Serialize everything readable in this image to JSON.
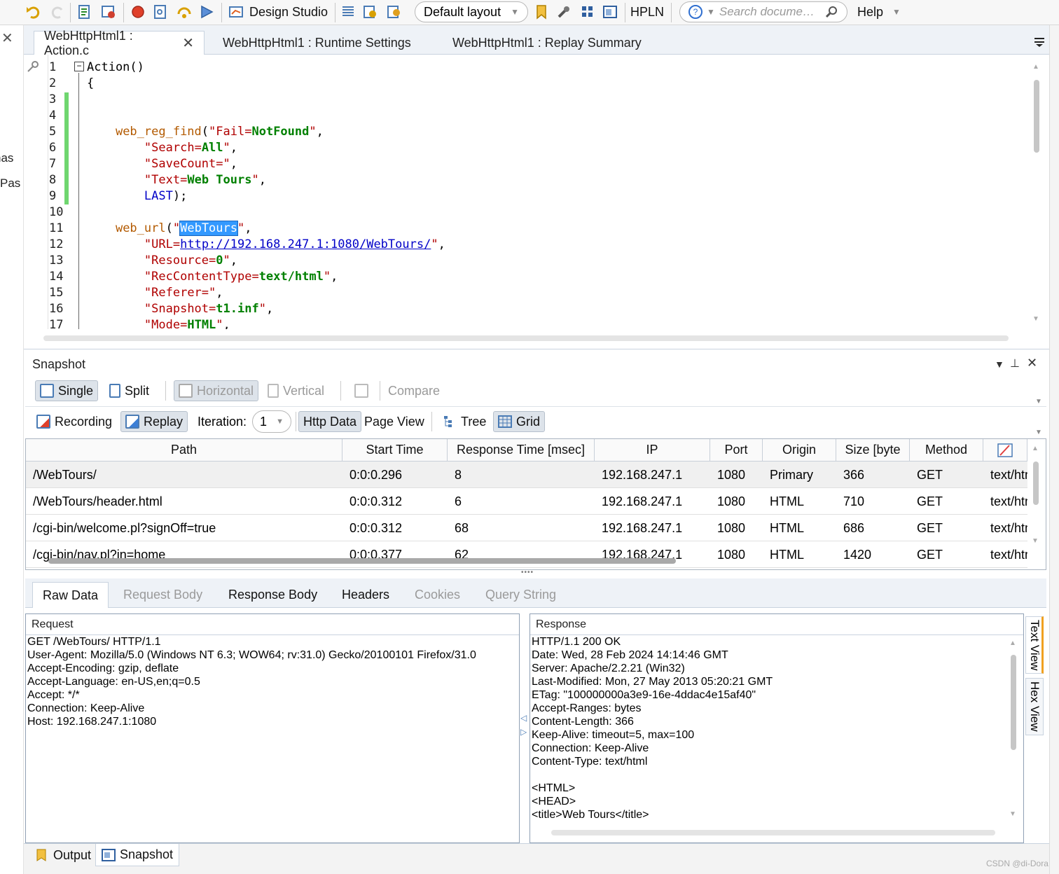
{
  "toolbar": {
    "design_studio": "Design Studio",
    "layout": "Default layout",
    "hpln": "HPLN",
    "search_placeholder": "Search docume…",
    "help": "Help"
  },
  "left_strip": {
    "item1": "nas",
    "item2": "Pas"
  },
  "doc_tabs": [
    {
      "label": "WebHttpHtml1 : Action.c"
    },
    {
      "label": "WebHttpHtml1 : Runtime Settings"
    },
    {
      "label": "WebHttpHtml1 : Replay Summary"
    }
  ],
  "code_lines": [
    "1",
    "2",
    "3",
    "4",
    "5",
    "6",
    "7",
    "8",
    "9",
    "10",
    "11",
    "12",
    "13",
    "14",
    "15",
    "16",
    "17"
  ],
  "code": {
    "l1": "Action()",
    "l2": "{",
    "l5_fn": "web_reg_find",
    "l5_a": "(\"",
    "l5_b": "Fail",
    "l5_c": "=",
    "l5_d": "NotFound",
    "l5_e": "\",",
    "l6_b": "Search",
    "l6_d": "All",
    "l7_b": "SaveCount",
    "l8_b": "Text",
    "l8_d": "Web Tours",
    "l9": "LAST",
    "l11_fn": "web_url",
    "l11_sel": "WebTours",
    "l12_b": "URL",
    "l12_url": "http://192.168.247.1:1080/WebTours/",
    "l13_b": "Resource",
    "l13_d": "0",
    "l14_b": "RecContentType",
    "l14_d": "text/html",
    "l15_b": "Referer",
    "l16_b": "Snapshot",
    "l16_d": "t1.inf",
    "l17_b": "Mode",
    "l17_d": "HTML"
  },
  "snapshot": {
    "title": "Snapshot",
    "single": "Single",
    "split": "Split",
    "horizontal": "Horizontal",
    "vertical": "Vertical",
    "compare": "Compare",
    "recording": "Recording",
    "replay": "Replay",
    "iteration_label": "Iteration:",
    "iteration_value": "1",
    "http_data": "Http Data",
    "page_view": "Page View",
    "tree": "Tree",
    "grid": "Grid"
  },
  "grid": {
    "headers": [
      "Path",
      "Start Time",
      "Response Time [msec]",
      "IP",
      "Port",
      "Origin",
      "Size [byte",
      "Method"
    ],
    "rows": [
      [
        "/WebTours/",
        "0:0:0.296",
        "8",
        "192.168.247.1",
        "1080",
        "Primary",
        "366",
        "GET",
        "text/htm"
      ],
      [
        "/WebTours/header.html",
        "0:0:0.312",
        "6",
        "192.168.247.1",
        "1080",
        "HTML",
        "710",
        "GET",
        "text/htm"
      ],
      [
        "/cgi-bin/welcome.pl?signOff=true",
        "0:0:0.312",
        "68",
        "192.168.247.1",
        "1080",
        "HTML",
        "686",
        "GET",
        "text/htm"
      ],
      [
        "/cgi-bin/nav.pl?in=home",
        "0:0:0.377",
        "62",
        "192.168.247.1",
        "1080",
        "HTML",
        "1420",
        "GET",
        "text/htm"
      ]
    ]
  },
  "raw_tabs": [
    "Raw Data",
    "Request Body",
    "Response Body",
    "Headers",
    "Cookies",
    "Query String"
  ],
  "request": {
    "title": "Request",
    "lines": [
      "GET /WebTours/ HTTP/1.1",
      "User-Agent: Mozilla/5.0 (Windows NT 6.3; WOW64; rv:31.0) Gecko/20100101 Firefox/31.0",
      "Accept-Encoding: gzip, deflate",
      "Accept-Language: en-US,en;q=0.5",
      "Accept: */*",
      "Connection: Keep-Alive",
      "Host: 192.168.247.1:1080"
    ]
  },
  "response": {
    "title": "Response",
    "lines": [
      "HTTP/1.1 200 OK",
      "Date: Wed, 28 Feb 2024 14:14:46 GMT",
      "Server: Apache/2.2.21 (Win32)",
      "Last-Modified: Mon, 27 May 2013 05:20:21 GMT",
      "ETag: \"100000000a3e9-16e-4ddac4e15af40\"",
      "Accept-Ranges: bytes",
      "Content-Length: 366",
      "Keep-Alive: timeout=5, max=100",
      "Connection: Keep-Alive",
      "Content-Type: text/html",
      "",
      "<HTML>",
      "<HEAD>",
      "<title>Web Tours</title>"
    ]
  },
  "side_tabs": {
    "text_view": "Text View",
    "hex_view": "Hex View"
  },
  "bottom_tabs": {
    "output": "Output",
    "snapshot": "Snapshot"
  },
  "watermark": "CSDN @di-Dora"
}
